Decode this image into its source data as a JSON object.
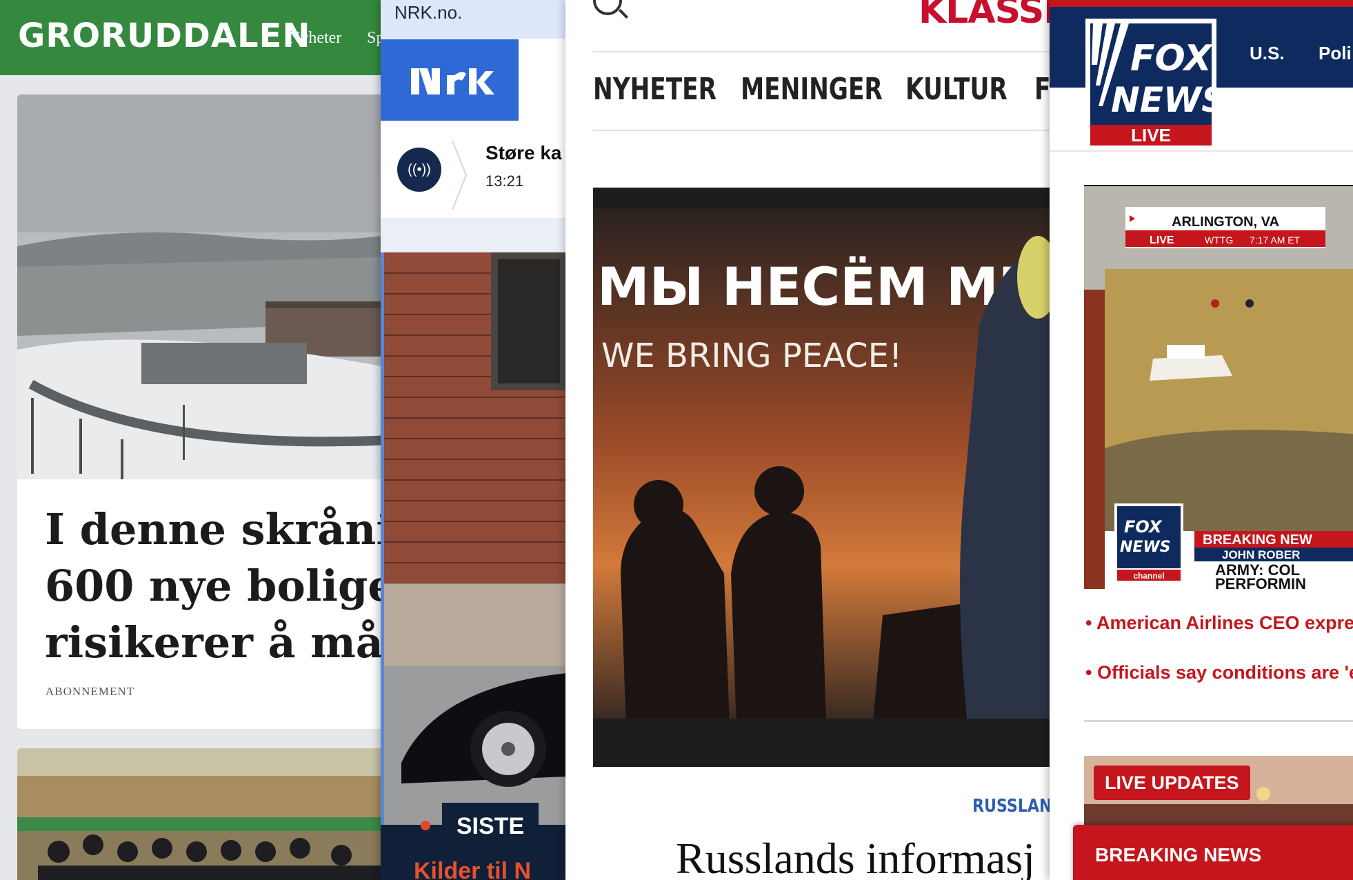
{
  "groruddalen": {
    "logo": "GRORUDDALEN",
    "nav": [
      "Nyheter",
      "Sp"
    ],
    "headline_lines": [
      "I denne skrånin",
      "600 nye boliger,",
      "risikerer å mått"
    ],
    "label": "ABONNEMENT",
    "colors": {
      "header": "#35893f",
      "background": "#e6e7ea"
    }
  },
  "nrk": {
    "url": "NRK.no.",
    "logo": "NRK",
    "live_title": "Støre ka",
    "live_time": "13:21",
    "siste": "SISTE",
    "teaser": "Kilder til N",
    "colors": {
      "logo_bg": "#2f69d5",
      "dark": "#0f2038",
      "accent": "#e8502e"
    }
  },
  "klassekampen": {
    "logo": "KLASSEKA",
    "nav": [
      "NYHETER",
      "MENINGER",
      "KULTUR",
      "FO"
    ],
    "photo_text_ru": "МЫ НЕСЁМ МИР!",
    "photo_text_en": "WE BRING PEACE!",
    "kicker": "RUSSLAN",
    "headline": "Russlands informasj",
    "colors": {
      "brand": "#c8102e",
      "kicker": "#2d5fae"
    }
  },
  "fox": {
    "logo_line1": "FOX",
    "logo_line2": "NEWS",
    "logo_live": "LIVE",
    "nav": [
      "U.S.",
      "Poli"
    ],
    "video": {
      "location": "ARLINGTON, VA",
      "live_label": "LIVE",
      "station": "WTTG",
      "time": "7:17 AM ET",
      "breaking": "BREAKING NEW",
      "reporter": "JOHN ROBER",
      "ticker_line1": "ARMY: COL",
      "ticker_line2": "PERFORMIN",
      "bug_line1": "FOX",
      "bug_line2": "NEWS",
      "bug_line3": "channel"
    },
    "bullets": [
      "American Airlines CEO expres",
      "Officials say conditions are 'e"
    ],
    "live_updates": "LIVE UPDATES",
    "breaking_news": "BREAKING NEWS",
    "colors": {
      "navy": "#0f2a5e",
      "red": "#c4161c"
    }
  }
}
